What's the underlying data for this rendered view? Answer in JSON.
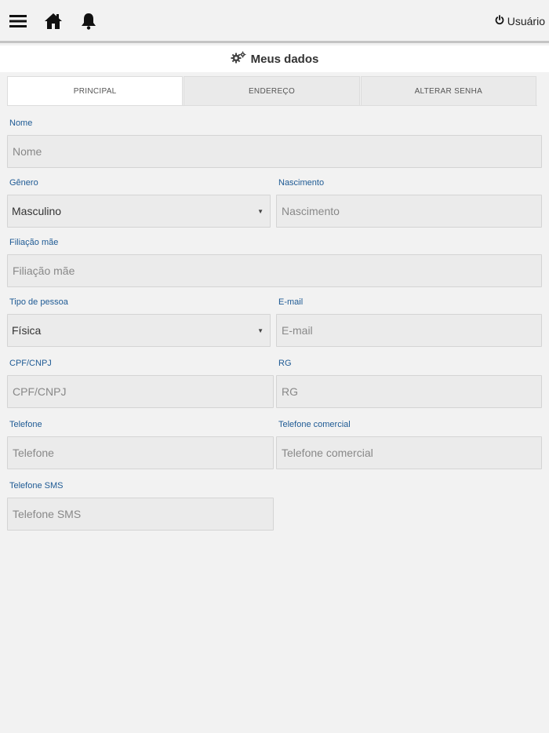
{
  "topbar": {
    "user_label": "Usuário",
    "icons": {
      "menu": "menu-icon",
      "home": "home-icon",
      "bell": "bell-icon",
      "power": "power-icon"
    }
  },
  "page": {
    "title": "Meus dados",
    "title_icon": "cogs-icon"
  },
  "tabs": [
    {
      "label": "PRINCIPAL",
      "active": true
    },
    {
      "label": "ENDEREÇO",
      "active": false
    },
    {
      "label": "ALTERAR SENHA",
      "active": false
    }
  ],
  "form": {
    "nome": {
      "label": "Nome",
      "placeholder": "Nome"
    },
    "genero": {
      "label": "Gênero",
      "value": "Masculino"
    },
    "nascimento": {
      "label": "Nascimento",
      "placeholder": "Nascimento"
    },
    "filiacao_mae": {
      "label": "Filiação mãe",
      "placeholder": "Filiação mãe"
    },
    "tipo_pessoa": {
      "label": "Tipo de pessoa",
      "value": "Física"
    },
    "email": {
      "label": "E-mail",
      "placeholder": "E-mail"
    },
    "cpf_cnpj": {
      "label": "CPF/CNPJ",
      "placeholder": "CPF/CNPJ"
    },
    "rg": {
      "label": "RG",
      "placeholder": "RG"
    },
    "telefone": {
      "label": "Telefone",
      "placeholder": "Telefone"
    },
    "telefone_comercial": {
      "label": "Telefone comercial",
      "placeholder": "Telefone comercial"
    },
    "telefone_sms": {
      "label": "Telefone SMS",
      "placeholder": "Telefone SMS"
    }
  }
}
